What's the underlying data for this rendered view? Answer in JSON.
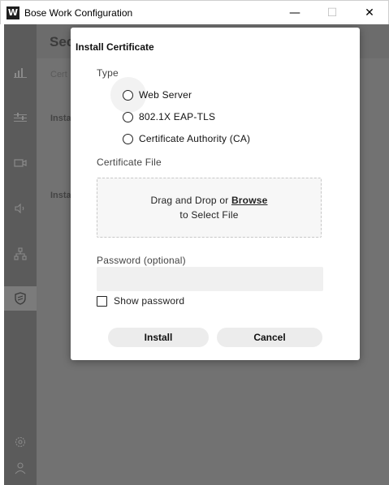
{
  "window": {
    "title": "Bose Work Configuration",
    "icon_glyph": "W",
    "minimize": "—",
    "maximize": "☐",
    "close": "✕"
  },
  "background": {
    "page_heading": "Sec",
    "sub_label": "Cert",
    "section1": "Insta",
    "section2": "Insta"
  },
  "sidebar": {
    "items": [
      {
        "name": "stats-icon",
        "glyph": "📶"
      },
      {
        "name": "sliders-icon",
        "glyph": "≡"
      },
      {
        "name": "camera-icon",
        "glyph": "▭"
      },
      {
        "name": "speaker-icon",
        "glyph": "◁"
      },
      {
        "name": "network-icon",
        "glyph": "品"
      },
      {
        "name": "shield-icon",
        "glyph": "⛉"
      },
      {
        "name": "settings-icon",
        "glyph": "⚙"
      },
      {
        "name": "user-icon",
        "glyph": "⚇"
      }
    ]
  },
  "modal": {
    "title": "Install Certificate",
    "type_label": "Type",
    "type_options": [
      "Web Server",
      "802.1X EAP-TLS",
      "Certificate Authority (CA)"
    ],
    "file_label": "Certificate File",
    "dropzone_prefix": "Drag and Drop or ",
    "dropzone_link": "Browse",
    "dropzone_line2": "to Select File",
    "password_label": "Password (optional)",
    "password_value": "",
    "password_placeholder": "",
    "show_password_label": "Show password",
    "install_label": "Install",
    "cancel_label": "Cancel"
  }
}
